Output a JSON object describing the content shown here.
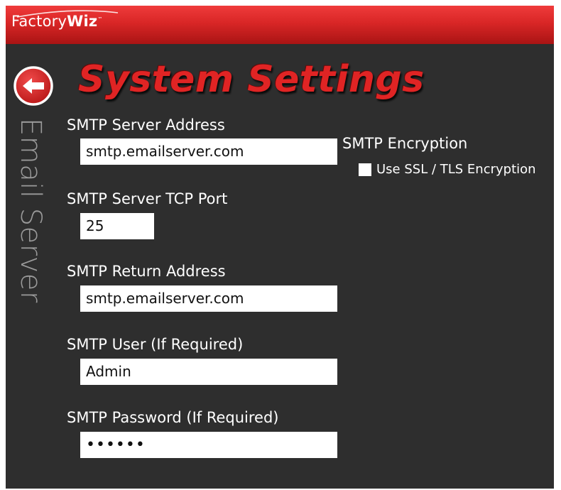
{
  "app": {
    "logo_light": "Factory",
    "logo_bold": "Wiz",
    "logo_trademark": "™",
    "brand_color": "#e02424"
  },
  "header": {
    "title": "System Settings",
    "back_icon": "back-arrow-circle-icon"
  },
  "section": {
    "label": "Email Server"
  },
  "fields": {
    "server_address": {
      "label": "SMTP Server Address",
      "value": "smtp.emailserver.com"
    },
    "tcp_port": {
      "label": "SMTP Server TCP Port",
      "value": "25"
    },
    "return_address": {
      "label": "SMTP Return Address",
      "value": "smtp.emailserver.com"
    },
    "user": {
      "label": "SMTP User (If Required)",
      "value": "Admin"
    },
    "password": {
      "label": "SMTP Password (If Required)",
      "value": "••••••"
    }
  },
  "encryption": {
    "title": "SMTP Encryption",
    "checkbox_label": "Use SSL / TLS Encryption",
    "checked": false
  }
}
